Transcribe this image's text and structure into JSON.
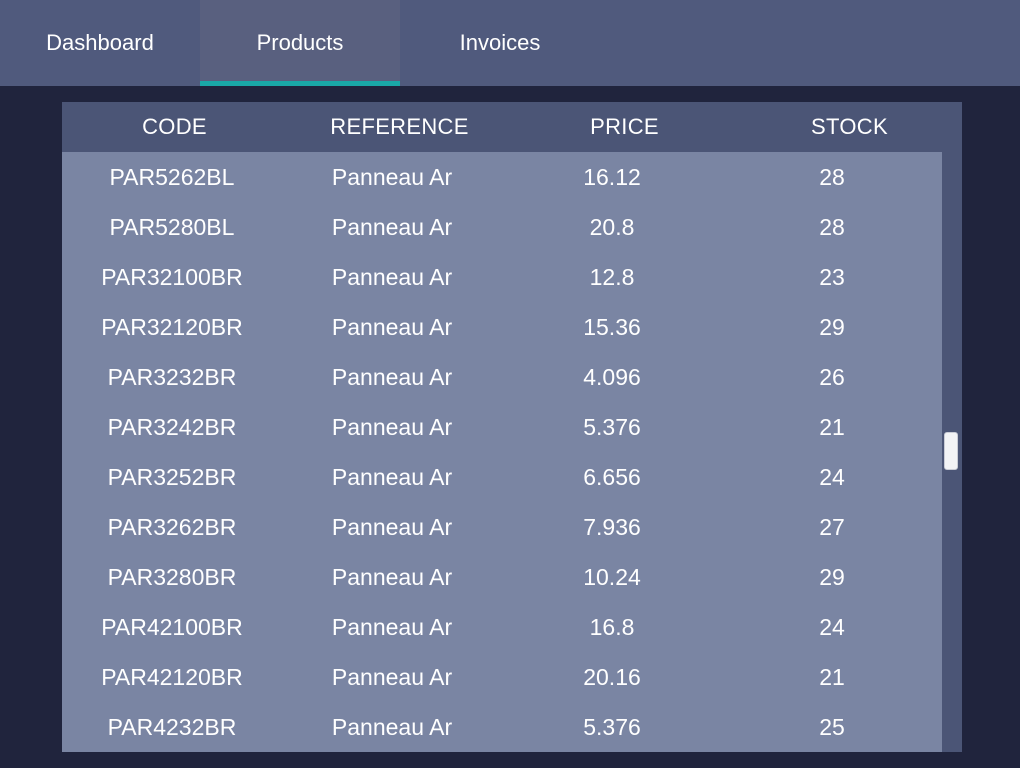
{
  "tabs": [
    {
      "label": "Dashboard",
      "active": false
    },
    {
      "label": "Products",
      "active": true
    },
    {
      "label": "Invoices",
      "active": false
    }
  ],
  "colors": {
    "background": "#20243d",
    "tabbar": "#505a7d",
    "active_indicator": "#1aa8a8",
    "table_header": "#4b5576",
    "table_body": "#7a85a3"
  },
  "table": {
    "columns": [
      "CODE",
      "REFERENCE",
      "PRICE",
      "STOCK"
    ],
    "rows": [
      {
        "code": "PAR5262BL",
        "reference": "Panneau Ar",
        "price": "16.12",
        "stock": "28"
      },
      {
        "code": "PAR5280BL",
        "reference": "Panneau Ar",
        "price": "20.8",
        "stock": "28"
      },
      {
        "code": "PAR32100BR",
        "reference": "Panneau Ar",
        "price": "12.8",
        "stock": "23"
      },
      {
        "code": "PAR32120BR",
        "reference": "Panneau Ar",
        "price": "15.36",
        "stock": "29"
      },
      {
        "code": "PAR3232BR",
        "reference": "Panneau Ar",
        "price": "4.096",
        "stock": "26"
      },
      {
        "code": "PAR3242BR",
        "reference": "Panneau Ar",
        "price": "5.376",
        "stock": "21"
      },
      {
        "code": "PAR3252BR",
        "reference": "Panneau Ar",
        "price": "6.656",
        "stock": "24"
      },
      {
        "code": "PAR3262BR",
        "reference": "Panneau Ar",
        "price": "7.936",
        "stock": "27"
      },
      {
        "code": "PAR3280BR",
        "reference": "Panneau Ar",
        "price": "10.24",
        "stock": "29"
      },
      {
        "code": "PAR42100BR",
        "reference": "Panneau Ar",
        "price": "16.8",
        "stock": "24"
      },
      {
        "code": "PAR42120BR",
        "reference": "Panneau Ar",
        "price": "20.16",
        "stock": "21"
      },
      {
        "code": "PAR4232BR",
        "reference": "Panneau Ar",
        "price": "5.376",
        "stock": "25"
      }
    ]
  }
}
